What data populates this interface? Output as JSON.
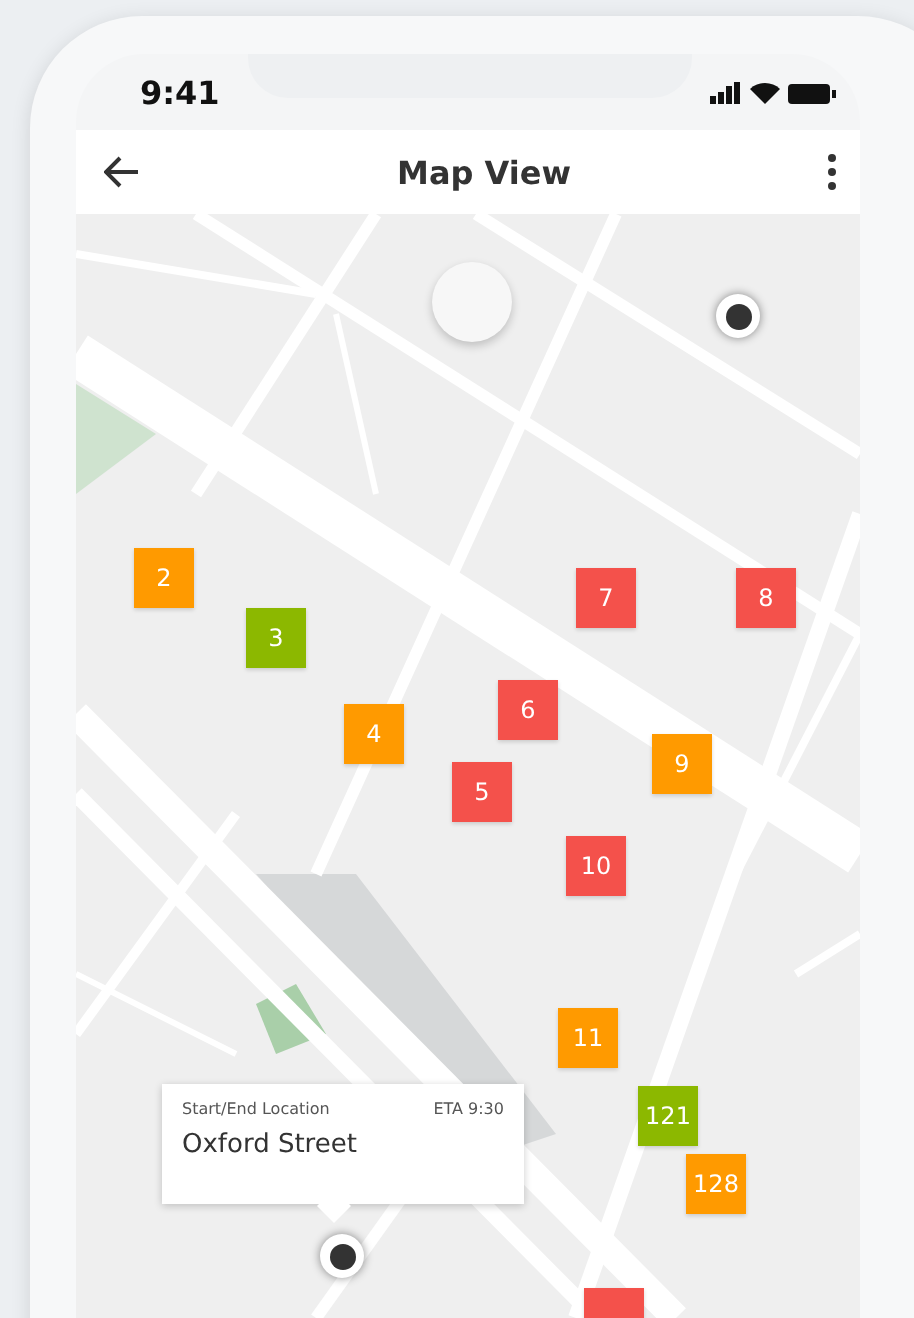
{
  "status_bar": {
    "time": "9:41"
  },
  "header": {
    "title": "Map View"
  },
  "map": {
    "markers": [
      {
        "label": "2",
        "color": "#ff9a00"
      },
      {
        "label": "3",
        "color": "#8cb800"
      },
      {
        "label": "4",
        "color": "#ff9a00"
      },
      {
        "label": "5",
        "color": "#f4514b"
      },
      {
        "label": "6",
        "color": "#f4514b"
      },
      {
        "label": "7",
        "color": "#f4514b"
      },
      {
        "label": "8",
        "color": "#f4514b"
      },
      {
        "label": "9",
        "color": "#ff9a00"
      },
      {
        "label": "10",
        "color": "#f4514b"
      },
      {
        "label": "11",
        "color": "#ff9a00"
      },
      {
        "label": "121",
        "color": "#8cb800"
      },
      {
        "label": "128",
        "color": "#ff9a00"
      },
      {
        "color": "#f4514b"
      }
    ],
    "callout": {
      "caption": "Start/End Location",
      "eta": "ETA 9:30",
      "place": "Oxford Street"
    }
  }
}
